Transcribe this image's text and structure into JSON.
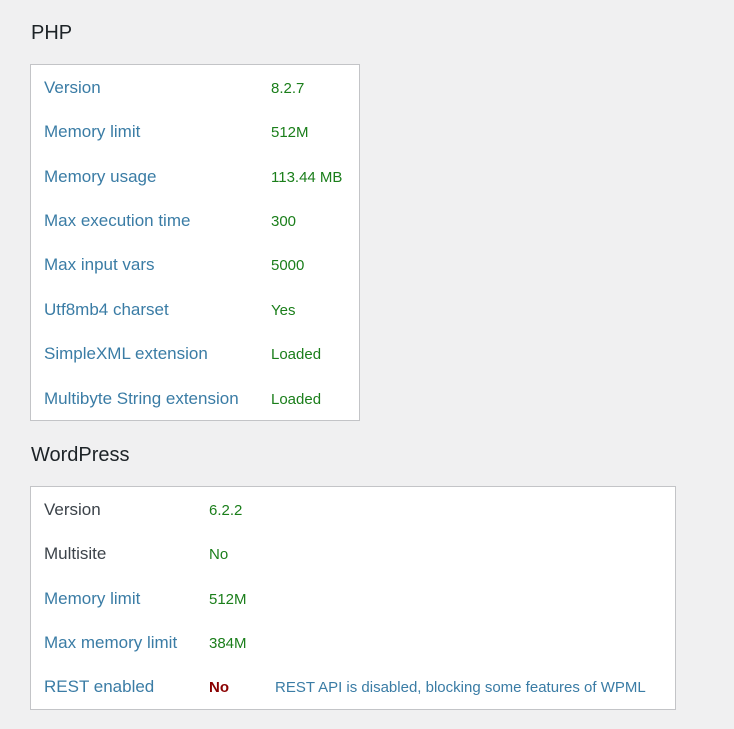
{
  "php": {
    "title": "PHP",
    "rows": [
      {
        "label": "Version",
        "value": "8.2.7"
      },
      {
        "label": "Memory limit",
        "value": "512M"
      },
      {
        "label": "Memory usage",
        "value": "113.44 MB"
      },
      {
        "label": "Max execution time",
        "value": "300"
      },
      {
        "label": "Max input vars",
        "value": "5000"
      },
      {
        "label": "Utf8mb4 charset",
        "value": "Yes"
      },
      {
        "label": "SimpleXML extension",
        "value": "Loaded"
      },
      {
        "label": "Multibyte String extension",
        "value": "Loaded"
      }
    ]
  },
  "wordpress": {
    "title": "WordPress",
    "rows": [
      {
        "label": "Version",
        "value": "6.2.2"
      },
      {
        "label": "Multisite",
        "value": "No"
      },
      {
        "label": "Memory limit",
        "value": "512M"
      },
      {
        "label": "Max memory limit",
        "value": "384M"
      },
      {
        "label": "REST enabled",
        "value": "No",
        "note": "REST API is disabled, blocking some features of WPML"
      }
    ]
  },
  "colors": {
    "background": "#f0f0f1",
    "label": "#3a7ca5",
    "ok_value": "#1a7e1a",
    "error_value": "#8a0000"
  }
}
